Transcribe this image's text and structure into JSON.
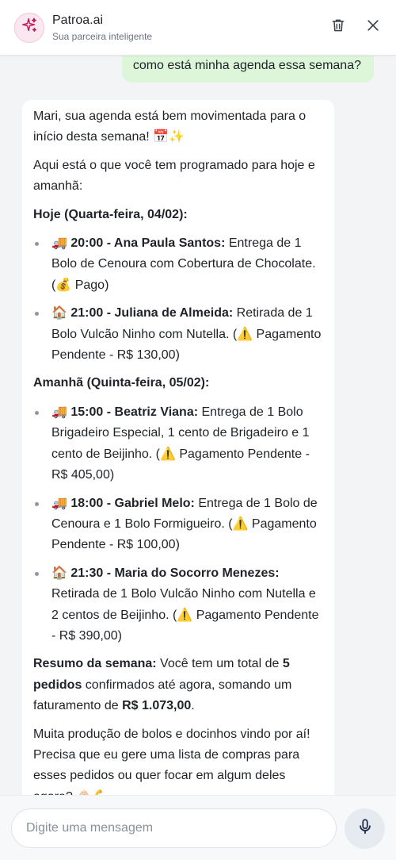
{
  "header": {
    "title": "Patroa.ai",
    "subtitle": "Sua parceira inteligente",
    "avatar_icon": "sparkles-icon",
    "accent": "#c2185b"
  },
  "chat": {
    "user_message": "como está minha agenda essa semana?",
    "ai": {
      "intro": "Mari, sua agenda está bem movimentada para o início desta semana! 📅✨",
      "lead": "Aqui está o que você tem programado para hoje e amanhã:",
      "today_heading": "Hoje (Quarta-feira, 04/02):",
      "today": [
        {
          "emoji": "🚚",
          "bold": "20:00 - Ana Paula Santos:",
          "text": " Entrega de 1 Bolo de Cenoura com Cobertura de Chocolate. (💰 Pago)"
        },
        {
          "emoji": "🏠",
          "bold": "21:00 - Juliana de Almeida:",
          "text": " Retirada de 1 Bolo Vulcão Ninho com Nutella. (⚠️ Pagamento Pendente - R$ 130,00)"
        }
      ],
      "tomorrow_heading": "Amanhã (Quinta-feira, 05/02):",
      "tomorrow": [
        {
          "emoji": "🚚",
          "bold": "15:00 - Beatriz Viana:",
          "text": " Entrega de 1 Bolo Brigadeiro Especial, 1 cento de Brigadeiro e 1 cento de Beijinho. (⚠️ Pagamento Pendente - R$ 405,00)"
        },
        {
          "emoji": "🚚",
          "bold": "18:00 - Gabriel Melo:",
          "text": " Entrega de 1 Bolo de Cenoura e 1 Bolo Formigueiro. (⚠️ Pagamento Pendente - R$ 100,00)"
        },
        {
          "emoji": "🏠",
          "bold": "21:30 - Maria do Socorro Menezes:",
          "text": " Retirada de 1 Bolo Vulcão Ninho com Nutella e 2 centos de Beijinho. (⚠️ Pagamento Pendente - R$ 390,00)"
        }
      ],
      "summary": {
        "label": "Resumo da semana:",
        "part1": " Você tem um total de ",
        "count": "5 pedidos",
        "part2": " confirmados até agora, somando um faturamento de ",
        "total": "R$ 1.073,00",
        "part3": "."
      },
      "closing": "Muita produção de bolos e docinhos vindo por aí! Precisa que eu gere uma lista de compras para esses pedidos ou quer focar em algum deles agora? 🧁💪"
    }
  },
  "composer": {
    "placeholder": "Digite uma mensagem",
    "mic_icon": "microphone-icon"
  }
}
